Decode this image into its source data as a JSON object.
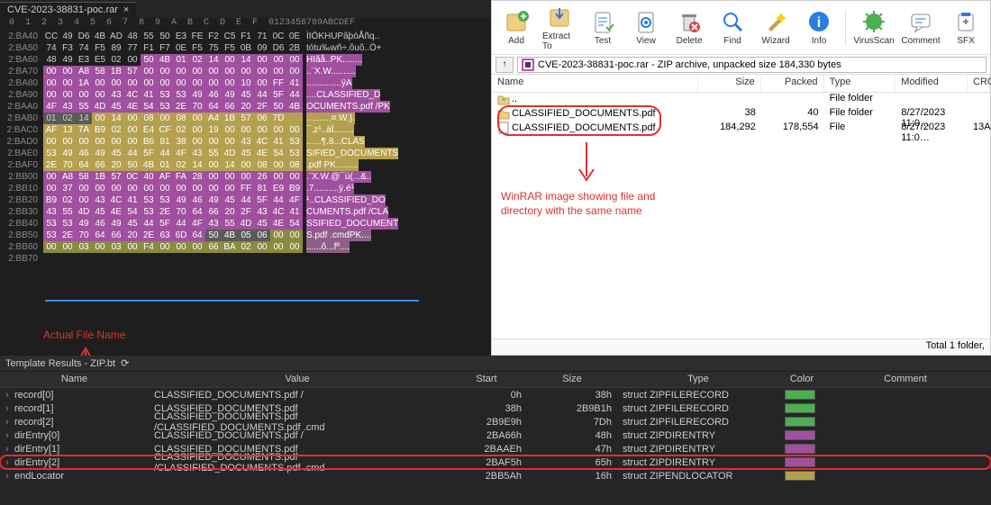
{
  "hex": {
    "tab_title": "CVE-2023-38831-poc.rar",
    "header": " 0  1  2  3  4  5  6  7  8  9  A  B  C  D  E  F  0123456789ABCDEF",
    "rows": [
      {
        "off": "2:BA40",
        "b": [
          "CC",
          "49",
          "D6",
          "4B",
          "AD",
          "48",
          "55",
          "50",
          "E3",
          "FE",
          "F2",
          "C5",
          "F1",
          "71",
          "0C",
          "0E"
        ],
        "a": "ÌIÖK­HUPãþòÅñq..",
        "cls": ""
      },
      {
        "off": "2:BA50",
        "b": [
          "74",
          "F3",
          "74",
          "F5",
          "89",
          "77",
          "F1",
          "F7",
          "0E",
          "F5",
          "75",
          "F5",
          "0B",
          "09",
          "D6",
          "2B"
        ],
        "a": "tótu‰wñ÷.õuõ..Ö+",
        "cls": ""
      },
      {
        "off": "2:BA60",
        "b": [
          "48",
          "49",
          "E3",
          "E5",
          "02",
          "00",
          "50",
          "4B",
          "01",
          "02",
          "14",
          "00",
          "14",
          "00",
          "00",
          "00"
        ],
        "a": "HIãå..PK........",
        "cls": "pkstart"
      },
      {
        "off": "2:BA70",
        "b": [
          "00",
          "00",
          "A8",
          "58",
          "1B",
          "57",
          "00",
          "00",
          "00",
          "00",
          "00",
          "00",
          "00",
          "00",
          "00",
          "00"
        ],
        "a": "..¨X.W..........",
        "cls": "bg-purple"
      },
      {
        "off": "2:BA80",
        "b": [
          "00",
          "00",
          "1A",
          "00",
          "00",
          "00",
          "00",
          "00",
          "00",
          "00",
          "00",
          "00",
          "10",
          "00",
          "FF",
          "41"
        ],
        "a": "..............ÿA",
        "cls": "bg-purple"
      },
      {
        "off": "2:BA90",
        "b": [
          "00",
          "00",
          "00",
          "00",
          "43",
          "4C",
          "41",
          "53",
          "53",
          "49",
          "46",
          "49",
          "45",
          "44",
          "5F",
          "44"
        ],
        "a": "....CLASSIFIED_D",
        "cls": "bg-purple"
      },
      {
        "off": "2:BAA0",
        "b": [
          "4F",
          "43",
          "55",
          "4D",
          "45",
          "4E",
          "54",
          "53",
          "2E",
          "70",
          "64",
          "66",
          "20",
          "2F",
          "50",
          "4B"
        ],
        "a": "OCUMENTS.pdf /PK",
        "cls": "bg-purple"
      },
      {
        "off": "2:BAB0",
        "b": [
          "01",
          "02",
          "14",
          "00",
          "14",
          "00",
          "08",
          "00",
          "08",
          "00",
          "A4",
          "1B",
          "57",
          "06",
          "7D",
          "sel"
        ],
        "a": "..........¤.W.}.",
        "cls": "pk2"
      },
      {
        "off": "2:BAC0",
        "b": [
          "AF",
          "13",
          "7A",
          "B9",
          "02",
          "00",
          "E4",
          "CF",
          "02",
          "00",
          "19",
          "00",
          "00",
          "00",
          "00",
          "00"
        ],
        "a": "¯.z¹..äÏ........",
        "cls": "bg-yellow"
      },
      {
        "off": "2:BAD0",
        "b": [
          "00",
          "00",
          "00",
          "00",
          "00",
          "00",
          "B6",
          "81",
          "38",
          "00",
          "00",
          "00",
          "43",
          "4C",
          "41",
          "53"
        ],
        "a": "......¶.8...CLAS",
        "cls": "bg-yellow"
      },
      {
        "off": "2:BAE0",
        "b": [
          "53",
          "49",
          "46",
          "49",
          "45",
          "44",
          "5F",
          "44",
          "4F",
          "43",
          "55",
          "4D",
          "45",
          "4E",
          "54",
          "53"
        ],
        "a": "SIFIED_DOCUMENTS",
        "cls": "bg-yellow"
      },
      {
        "off": "2:BAF0",
        "b": [
          "2E",
          "70",
          "64",
          "66",
          "20",
          "50",
          "4B",
          "01",
          "02",
          "14",
          "00",
          "14",
          "00",
          "08",
          "00",
          "08"
        ],
        "a": ".pdf PK.........",
        "cls": "bg-yellow"
      },
      {
        "off": "2:BB00",
        "b": [
          "00",
          "A8",
          "58",
          "1B",
          "57",
          "0C",
          "40",
          "AF",
          "FA",
          "28",
          "00",
          "00",
          "00",
          "26",
          "00",
          "00"
        ],
        "a": ".¨X.W.@¯ú(...&..",
        "cls": "bg-purple"
      },
      {
        "off": "2:BB10",
        "b": [
          "00",
          "37",
          "00",
          "00",
          "00",
          "00",
          "00",
          "00",
          "00",
          "00",
          "00",
          "00",
          "FF",
          "81",
          "E9",
          "B9"
        ],
        "a": ".7..........ÿ.é¹",
        "cls": "bg-purple"
      },
      {
        "off": "2:BB20",
        "b": [
          "B9",
          "02",
          "00",
          "43",
          "4C",
          "41",
          "53",
          "53",
          "49",
          "46",
          "49",
          "45",
          "44",
          "5F",
          "44",
          "4F"
        ],
        "a": "¹..CLASSIFIED_DO",
        "cls": "bg-purple"
      },
      {
        "off": "2:BB30",
        "b": [
          "43",
          "55",
          "4D",
          "45",
          "4E",
          "54",
          "53",
          "2E",
          "70",
          "64",
          "66",
          "20",
          "2F",
          "43",
          "4C",
          "41"
        ],
        "a": "CUMENTS.pdf /CLA",
        "cls": "bg-purple"
      },
      {
        "off": "2:BB40",
        "b": [
          "53",
          "53",
          "49",
          "46",
          "49",
          "45",
          "44",
          "5F",
          "44",
          "4F",
          "43",
          "55",
          "4D",
          "45",
          "4E",
          "54"
        ],
        "a": "SSIFIED_DOCUMENT",
        "cls": "bg-purple"
      },
      {
        "off": "2:BB50",
        "b": [
          "53",
          "2E",
          "70",
          "64",
          "66",
          "20",
          "2E",
          "63",
          "6D",
          "64",
          "50",
          "4B",
          "05",
          "06",
          "00",
          "00"
        ],
        "a": "S.pdf .cmdPK....",
        "cls": "pkend"
      },
      {
        "off": "2:BB60",
        "b": [
          "00",
          "00",
          "03",
          "00",
          "03",
          "00",
          "F4",
          "00",
          "00",
          "00",
          "66",
          "BA",
          "02",
          "00",
          "00",
          "00"
        ],
        "a": "......ô...fº....",
        "cls": "bg-olive"
      },
      {
        "off": "2:BB70",
        "b": [
          "",
          "",
          "",
          "",
          "",
          "",
          "",
          "",
          "",
          "",
          "",
          "",
          "",
          "",
          "",
          ""
        ],
        "a": "",
        "cls": ""
      }
    ]
  },
  "annotations": {
    "actual_file": "Actual File Name",
    "winrar_note_1": "WinRAR image showing file and",
    "winrar_note_2": "directory with the same name"
  },
  "winrar": {
    "toolbar": [
      {
        "id": "add",
        "label": "Add"
      },
      {
        "id": "extract",
        "label": "Extract To"
      },
      {
        "id": "test",
        "label": "Test"
      },
      {
        "id": "view",
        "label": "View"
      },
      {
        "id": "delete",
        "label": "Delete"
      },
      {
        "id": "find",
        "label": "Find"
      },
      {
        "id": "wizard",
        "label": "Wizard"
      },
      {
        "id": "info",
        "label": "Info"
      },
      {
        "id": "virus",
        "label": "VirusScan"
      },
      {
        "id": "comment",
        "label": "Comment"
      },
      {
        "id": "sfx",
        "label": "SFX"
      }
    ],
    "address": "CVE-2023-38831-poc.rar - ZIP archive, unpacked size 184,330 bytes",
    "columns": {
      "name": "Name",
      "size": "Size",
      "packed": "Packed",
      "type": "Type",
      "modified": "Modified",
      "crc": "CRC"
    },
    "rows": [
      {
        "name": "..",
        "size": "",
        "packed": "",
        "type": "File folder",
        "mod": "",
        "icon": "folder-up"
      },
      {
        "name": "CLASSIFIED_DOCUMENTS.pdf",
        "size": "38",
        "packed": "40",
        "type": "File folder",
        "mod": "8/27/2023 11:0…",
        "icon": "folder"
      },
      {
        "name": "CLASSIFIED_DOCUMENTS.pdf",
        "size": "184,292",
        "packed": "178,554",
        "type": "File",
        "mod": "8/27/2023 11:0…",
        "crc": "13A",
        "icon": "file"
      }
    ],
    "status": "Total 1 folder,"
  },
  "template": {
    "tab": "Template Results - ZIP.bt",
    "refresh_icon": "⟳",
    "columns": {
      "name": "Name",
      "value": "Value",
      "start": "Start",
      "size": "Size",
      "type": "Type",
      "color": "Color",
      "comment": "Comment"
    },
    "rows": [
      {
        "name": "record[0]",
        "value": "CLASSIFIED_DOCUMENTS.pdf /",
        "start": "0h",
        "size": "38h",
        "type": "struct ZIPFILERECORD",
        "sw": "sw-green"
      },
      {
        "name": "record[1]",
        "value": "CLASSIFIED_DOCUMENTS.pdf",
        "start": "38h",
        "size": "2B9B1h",
        "type": "struct ZIPFILERECORD",
        "sw": "sw-green"
      },
      {
        "name": "record[2]",
        "value": "CLASSIFIED_DOCUMENTS.pdf /CLASSIFIED_DOCUMENTS.pdf .cmd",
        "start": "2B9E9h",
        "size": "7Dh",
        "type": "struct ZIPFILERECORD",
        "sw": "sw-green"
      },
      {
        "name": "dirEntry[0]",
        "value": "CLASSIFIED_DOCUMENTS.pdf /",
        "start": "2BA66h",
        "size": "48h",
        "type": "struct ZIPDIRENTRY",
        "sw": "sw-purple"
      },
      {
        "name": "dirEntry[1]",
        "value": "CLASSIFIED_DOCUMENTS.pdf",
        "start": "2BAAEh",
        "size": "47h",
        "type": "struct ZIPDIRENTRY",
        "sw": "sw-purple"
      },
      {
        "name": "dirEntry[2]",
        "value": "CLASSIFIED_DOCUMENTS.pdf /CLASSIFIED_DOCUMENTS.pdf .cmd",
        "start": "2BAF5h",
        "size": "65h",
        "type": "struct ZIPDIRENTRY",
        "sw": "sw-purple",
        "hl": true
      },
      {
        "name": "endLocator",
        "value": "",
        "start": "2BB5Ah",
        "size": "16h",
        "type": "struct ZIPENDLOCATOR",
        "sw": "sw-olive"
      }
    ]
  }
}
